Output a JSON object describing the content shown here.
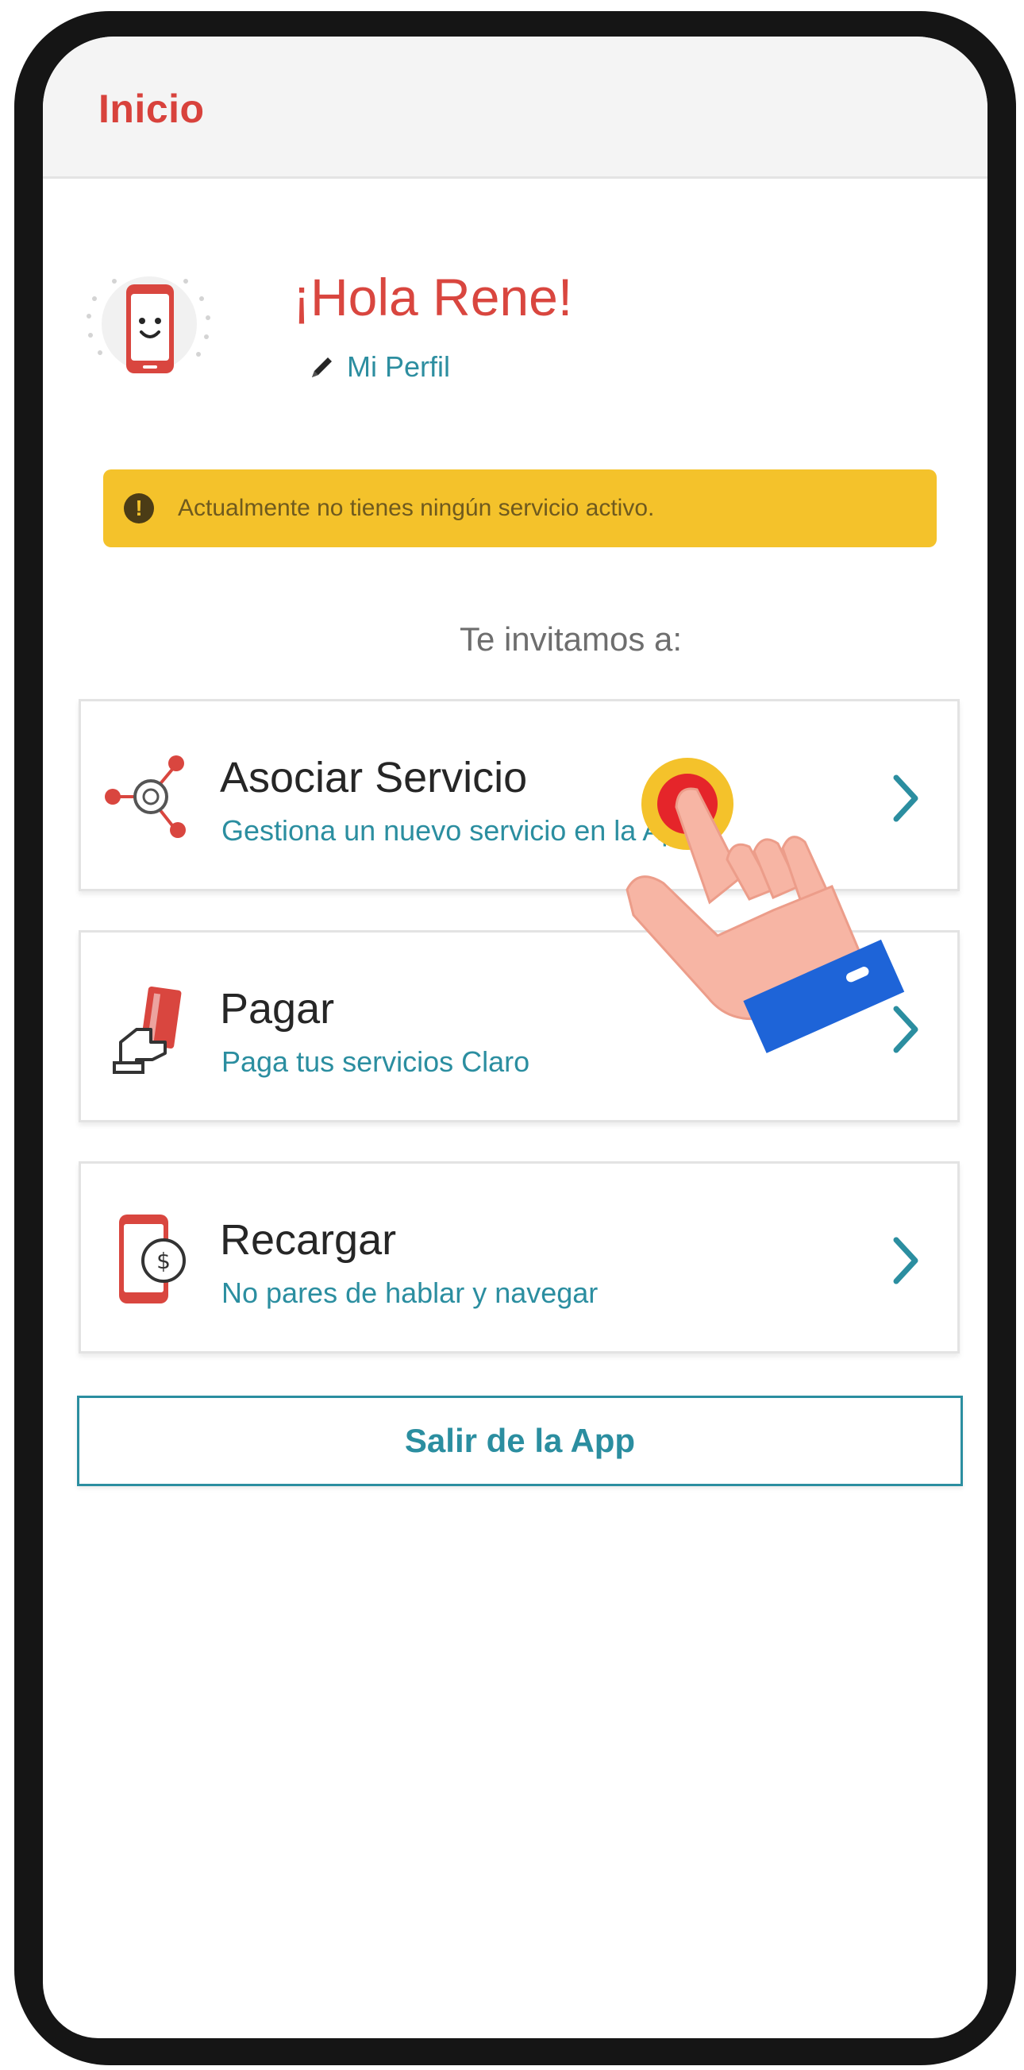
{
  "appbar": {
    "title": "Inicio"
  },
  "profile": {
    "greeting": "¡Hola Rene!",
    "profile_link": "Mi Perfil"
  },
  "alert": {
    "icon": "exclamation-icon",
    "text": "Actualmente no tienes ningún servicio activo."
  },
  "invite_text": "Te invitamos a:",
  "cards": [
    {
      "icon": "network-nodes-icon",
      "title": "Asociar Servicio",
      "subtitle": "Gestiona un nuevo servicio en la App"
    },
    {
      "icon": "card-payment-hand-icon",
      "title": "Pagar",
      "subtitle": "Paga tus servicios Claro"
    },
    {
      "icon": "phone-dollar-icon",
      "title": "Recargar",
      "subtitle": "No pares de hablar y navegar"
    }
  ],
  "exit_button": "Salir de la App",
  "colors": {
    "brand_red": "#d8423c",
    "accent_teal": "#2b8ea0",
    "alert_yellow": "#f4c22b"
  }
}
